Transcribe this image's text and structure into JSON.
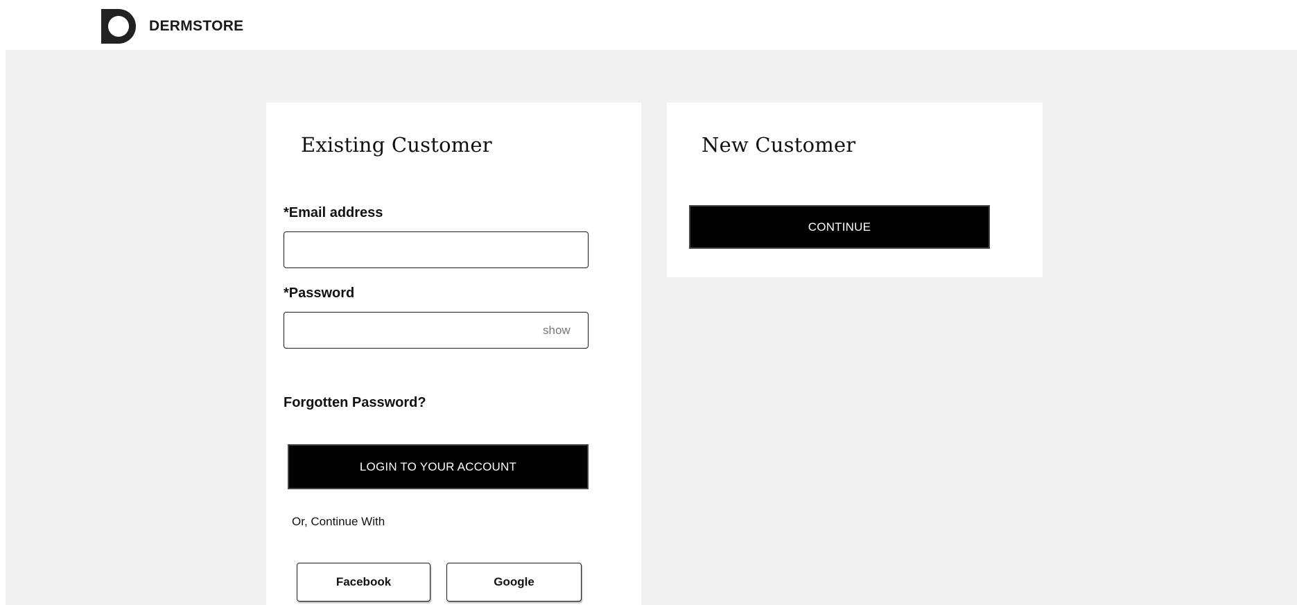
{
  "brand": {
    "name": "DERMSTORE",
    "logo_icon": "dermstore-logo-icon"
  },
  "existing_customer": {
    "title": "Existing Customer",
    "email_label": "*Email address",
    "email_value": "",
    "password_label": "*Password",
    "password_value": "",
    "show_label": "show",
    "forgot_password": "Forgotten Password?",
    "login_button": "LOGIN TO YOUR ACCOUNT",
    "or_continue": "Or, Continue With",
    "social": {
      "facebook": "Facebook",
      "google": "Google"
    }
  },
  "new_customer": {
    "title": "New Customer",
    "continue_button": "CONTINUE"
  },
  "colors": {
    "page_background": "#f1f1f1",
    "card_background": "#ffffff",
    "button_background": "#000000",
    "button_text": "#ffffff"
  }
}
